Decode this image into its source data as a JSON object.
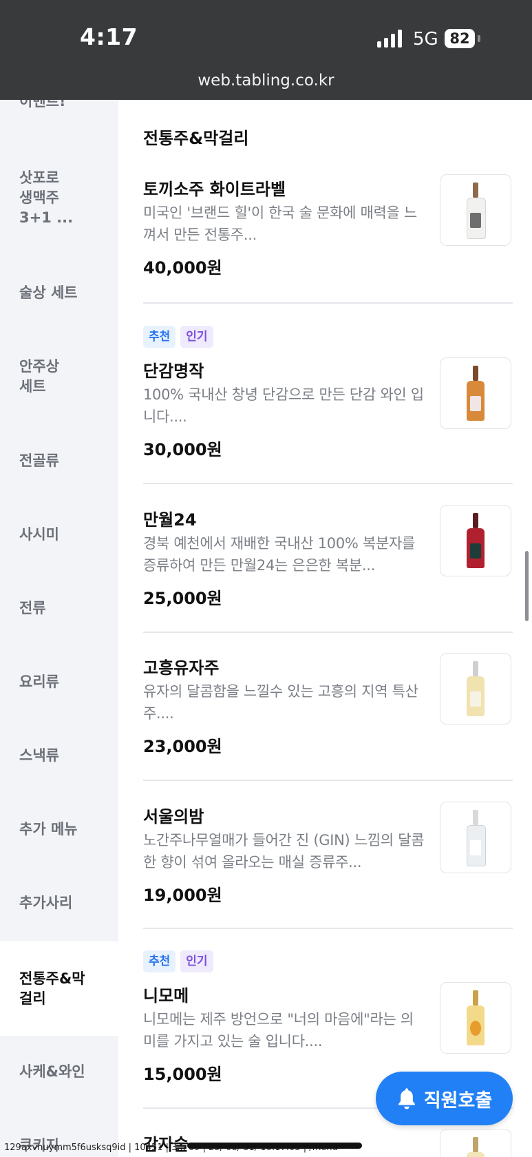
{
  "status_bar": {
    "time": "4:17",
    "network": "5G",
    "battery": "82",
    "url": "web.tabling.co.kr"
  },
  "sidebar": {
    "items": [
      {
        "label": "이벤트!"
      },
      {
        "label": "삿포로\n생맥주\n3+1 ..."
      },
      {
        "label": "술상 세트"
      },
      {
        "label": "안주상\n세트"
      },
      {
        "label": "전골류"
      },
      {
        "label": "사시미"
      },
      {
        "label": "전류"
      },
      {
        "label": "요리류"
      },
      {
        "label": "스낵류"
      },
      {
        "label": "추가 메뉴"
      },
      {
        "label": "추가사리"
      },
      {
        "label": "전통주&막\n걸리",
        "active": true
      },
      {
        "label": "사케&와인"
      },
      {
        "label": "쿠키지"
      }
    ]
  },
  "main": {
    "section_title": "전통주&막걸리",
    "tags": {
      "recommended": "추천",
      "popular": "인기"
    },
    "items": [
      {
        "name": "토끼소주 화이트라벨",
        "desc": "미국인 '브랜드 힐'이 한국 술 문화에 매력을 느껴서 만든 전통주...",
        "price": "40,000원",
        "tags": false,
        "bottle": {
          "neck": "#8d6a4a",
          "body": "#f1f1ef",
          "label": "#6e6e6e"
        }
      },
      {
        "name": "단감명작",
        "desc": "100% 국내산 창녕 단감으로 만든 단감 와인 입니다....",
        "price": "30,000원",
        "tags": true,
        "bottle": {
          "neck": "#7a4a2a",
          "body": "#d9893a",
          "label": "#f1e6e6"
        }
      },
      {
        "name": "만월24",
        "desc": "경북 예천에서 재배한 국내산 100% 복분자를 증류하여 만든 만월24는 은은한 복분...",
        "price": "25,000원",
        "tags": false,
        "bottle": {
          "neck": "#5a1d22",
          "body": "#b0202e",
          "label": "#1e3d3a"
        }
      },
      {
        "name": "고흥유자주",
        "desc": "유자의 달콤함을 느낄수 있는 고흥의 지역 특산주....",
        "price": "23,000원",
        "tags": false,
        "bottle": {
          "neck": "#cfcfcf",
          "body": "#f0e3b0",
          "label": "#f7f3e4"
        }
      },
      {
        "name": "서울의밤",
        "desc": "노간주나무열매가 들어간 진 (GIN) 느낌의 달콤한 향이 섞여 올라오는 매실 증류주...",
        "price": "19,000원",
        "tags": false,
        "bottle": {
          "neck": "#d9d9d9",
          "body": "#eceff1",
          "label": "#ffffff"
        }
      },
      {
        "name": "니모메",
        "desc": "니모메는 제주 방언으로 \"너의 마음에\"라는 의미를 가지고 있는 술 입니다....",
        "price": "15,000원",
        "tags": true,
        "bottle": {
          "neck": "#c9a24a",
          "body": "#f3d98a",
          "label": "#e79c2e"
        }
      },
      {
        "name": "감자술",
        "desc": "",
        "price": "",
        "tags": false,
        "bottle": {
          "neck": "#bfa56a",
          "body": "#f2e6b8",
          "label": "#ffffff"
        }
      }
    ]
  },
  "call_button": {
    "label": "직원호출",
    "color": "#2180f5"
  },
  "footer_debug": "129axvnuymm5f6usksq9id | 10451 | 3... 09 | 25/ 08/ 31/ 16:17:05 | /menu"
}
